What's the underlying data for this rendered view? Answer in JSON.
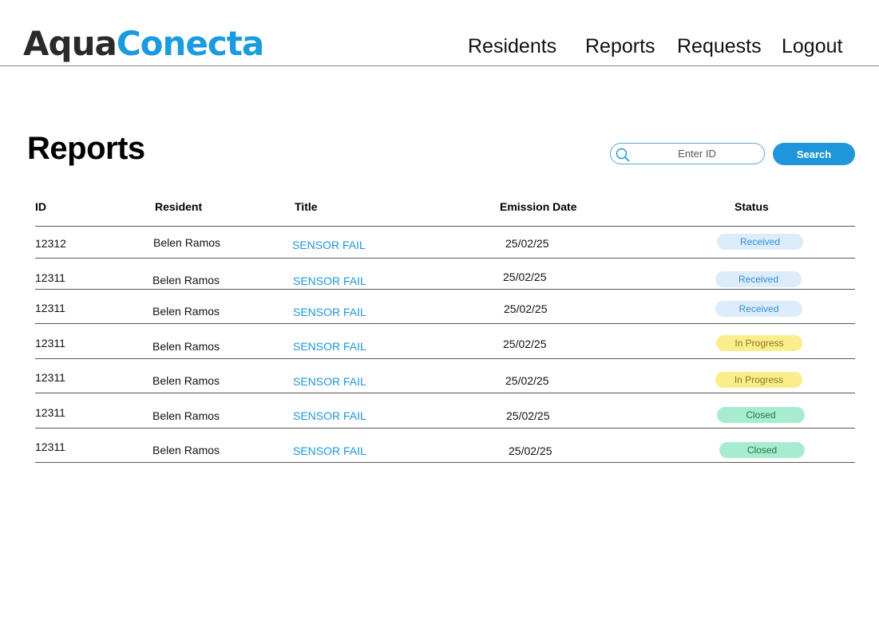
{
  "brand": {
    "part1": "Aqua",
    "part2": "Conecta",
    "color_dark": "#2a2a2a",
    "color_accent": "#1a9be0"
  },
  "nav": {
    "residents": "Residents",
    "reports": "Reports",
    "requests": "Requests",
    "logout": "Logout"
  },
  "page": {
    "title": "Reports"
  },
  "search": {
    "placeholder": "Enter ID",
    "value": "",
    "button_label": "Search",
    "icon": "search-icon"
  },
  "table": {
    "columns": {
      "id": "ID",
      "resident": "Resident",
      "title": "Title",
      "date": "Emission Date",
      "status": "Status"
    },
    "rows": [
      {
        "id": "12312",
        "resident": "Belen Ramos",
        "title": "SENSOR FAIL",
        "date": "25/02/25",
        "status": "Received"
      },
      {
        "id": "12311",
        "resident": "Belen Ramos",
        "title": "SENSOR FAIL",
        "date": "25/02/25",
        "status": "Received"
      },
      {
        "id": "12311",
        "resident": "Belen Ramos",
        "title": "SENSOR FAIL",
        "date": "25/02/25",
        "status": "Received"
      },
      {
        "id": "12311",
        "resident": "Belen Ramos",
        "title": "SENSOR FAIL",
        "date": "25/02/25",
        "status": "In Progress"
      },
      {
        "id": "12311",
        "resident": "Belen Ramos",
        "title": "SENSOR FAIL",
        "date": "25/02/25",
        "status": "In Progress"
      },
      {
        "id": "12311",
        "resident": "Belen Ramos",
        "title": "SENSOR FAIL",
        "date": "25/02/25",
        "status": "Closed"
      },
      {
        "id": "12311",
        "resident": "Belen Ramos",
        "title": "SENSOR FAIL",
        "date": "25/02/25",
        "status": "Closed"
      }
    ]
  },
  "status_colors": {
    "Received": {
      "bg": "#dcecfb",
      "fg": "#2f8fd6"
    },
    "In Progress": {
      "bg": "#fbec8c",
      "fg": "#8a7a1c"
    },
    "Closed": {
      "bg": "#a7ecd0",
      "fg": "#1a7a3e"
    }
  }
}
